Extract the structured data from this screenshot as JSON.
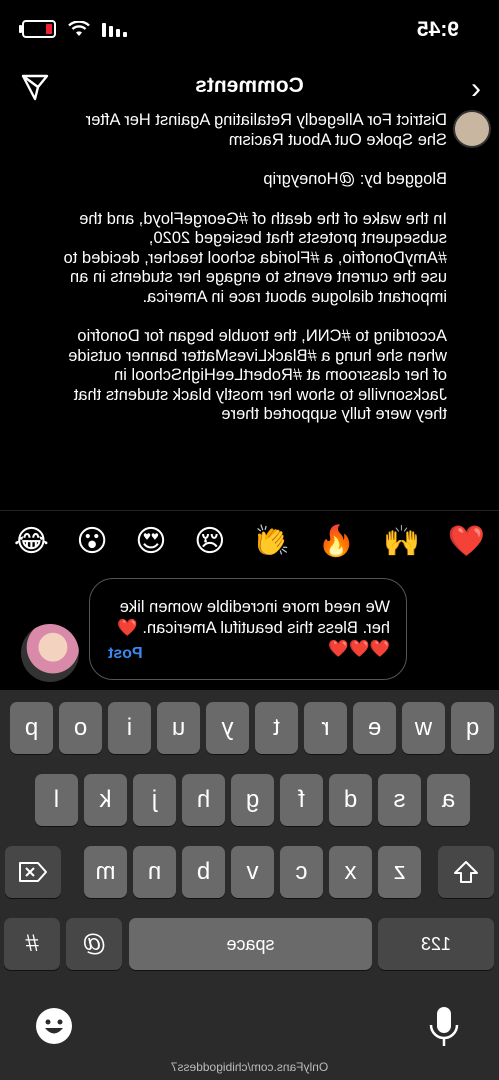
{
  "status_bar": {
    "time": "9:45"
  },
  "header": {
    "title": "Comments",
    "back_icon": "chevron-left-icon",
    "send_icon": "paper-plane-icon"
  },
  "caption": {
    "paragraphs": [
      "District For Allegedly Retaliating Against Her After She Spoke Out About Racism",
      "Blogged by: @Honeygrip",
      "In the wake of the death of #GeorgeFloyd, and the subsequent protests that besieged 2020, #AmyDonofrio, a #Florida school teacher, decided to use the current events to engage her students in an important dialogue about race in America.",
      "According to #CNN, the trouble began for Donofrio when she hung a #BlackLivesMatter banner outside of her classroom at #RobertLeeHighSchool in Jacksonville to show her mostly black students that they were fully supported there"
    ]
  },
  "emoji_bar": [
    "❤️",
    "🙌",
    "🔥",
    "👏",
    "😢",
    "😍",
    "😮",
    "😂"
  ],
  "comment_input": {
    "value": "We need more incredible women like her. Bless this beautiful American. ❤️❤️❤️❤️",
    "post_label": "Post"
  },
  "keyboard": {
    "row1": [
      "q",
      "w",
      "e",
      "r",
      "t",
      "y",
      "u",
      "i",
      "o",
      "p"
    ],
    "row2": [
      "a",
      "s",
      "d",
      "f",
      "g",
      "h",
      "j",
      "k",
      "l"
    ],
    "row3": [
      "z",
      "x",
      "c",
      "v",
      "b",
      "n",
      "m"
    ],
    "numbers_label": "123",
    "space_label": "space",
    "at_label": "@",
    "hash_label": "#"
  },
  "watermark": "OnlyFans.com/chibigoddess7"
}
